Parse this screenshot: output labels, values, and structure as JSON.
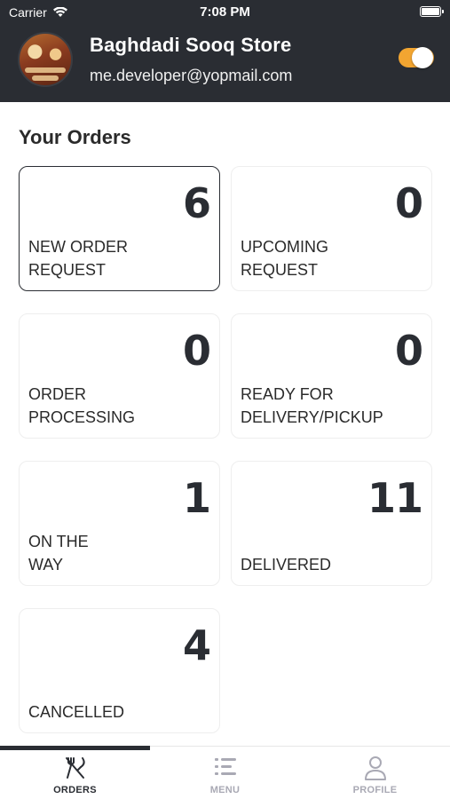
{
  "status_bar": {
    "carrier": "Carrier",
    "time": "7:08 PM"
  },
  "header": {
    "store_name": "Baghdadi Sooq Store",
    "email": "me.developer@yopmail.com",
    "toggle_on": true,
    "toggle_color": "#f2a531",
    "background_color": "#2a2d33"
  },
  "section_title": "Your Orders",
  "cards": [
    {
      "count": "6",
      "label": "NEW ORDER\nREQUEST"
    },
    {
      "count": "0",
      "label": "UPCOMING\nREQUEST"
    },
    {
      "count": "0",
      "label": "ORDER\nPROCESSING"
    },
    {
      "count": "0",
      "label": "READY FOR\nDELIVERY/PICKUP"
    },
    {
      "count": "1",
      "label": "ON THE\nWAY"
    },
    {
      "count": "11",
      "label": "DELIVERED"
    },
    {
      "count": "4",
      "label": "CANCELLED"
    }
  ],
  "tabs": [
    {
      "label": "ORDERS",
      "icon": "fork-knife-icon",
      "active": true
    },
    {
      "label": "MENU",
      "icon": "menu-list-icon",
      "active": false
    },
    {
      "label": "PROFILE",
      "icon": "profile-person-icon",
      "active": false
    }
  ],
  "colors": {
    "tab_active": "#2a2d33",
    "tab_inactive": "#a9a9b4"
  }
}
